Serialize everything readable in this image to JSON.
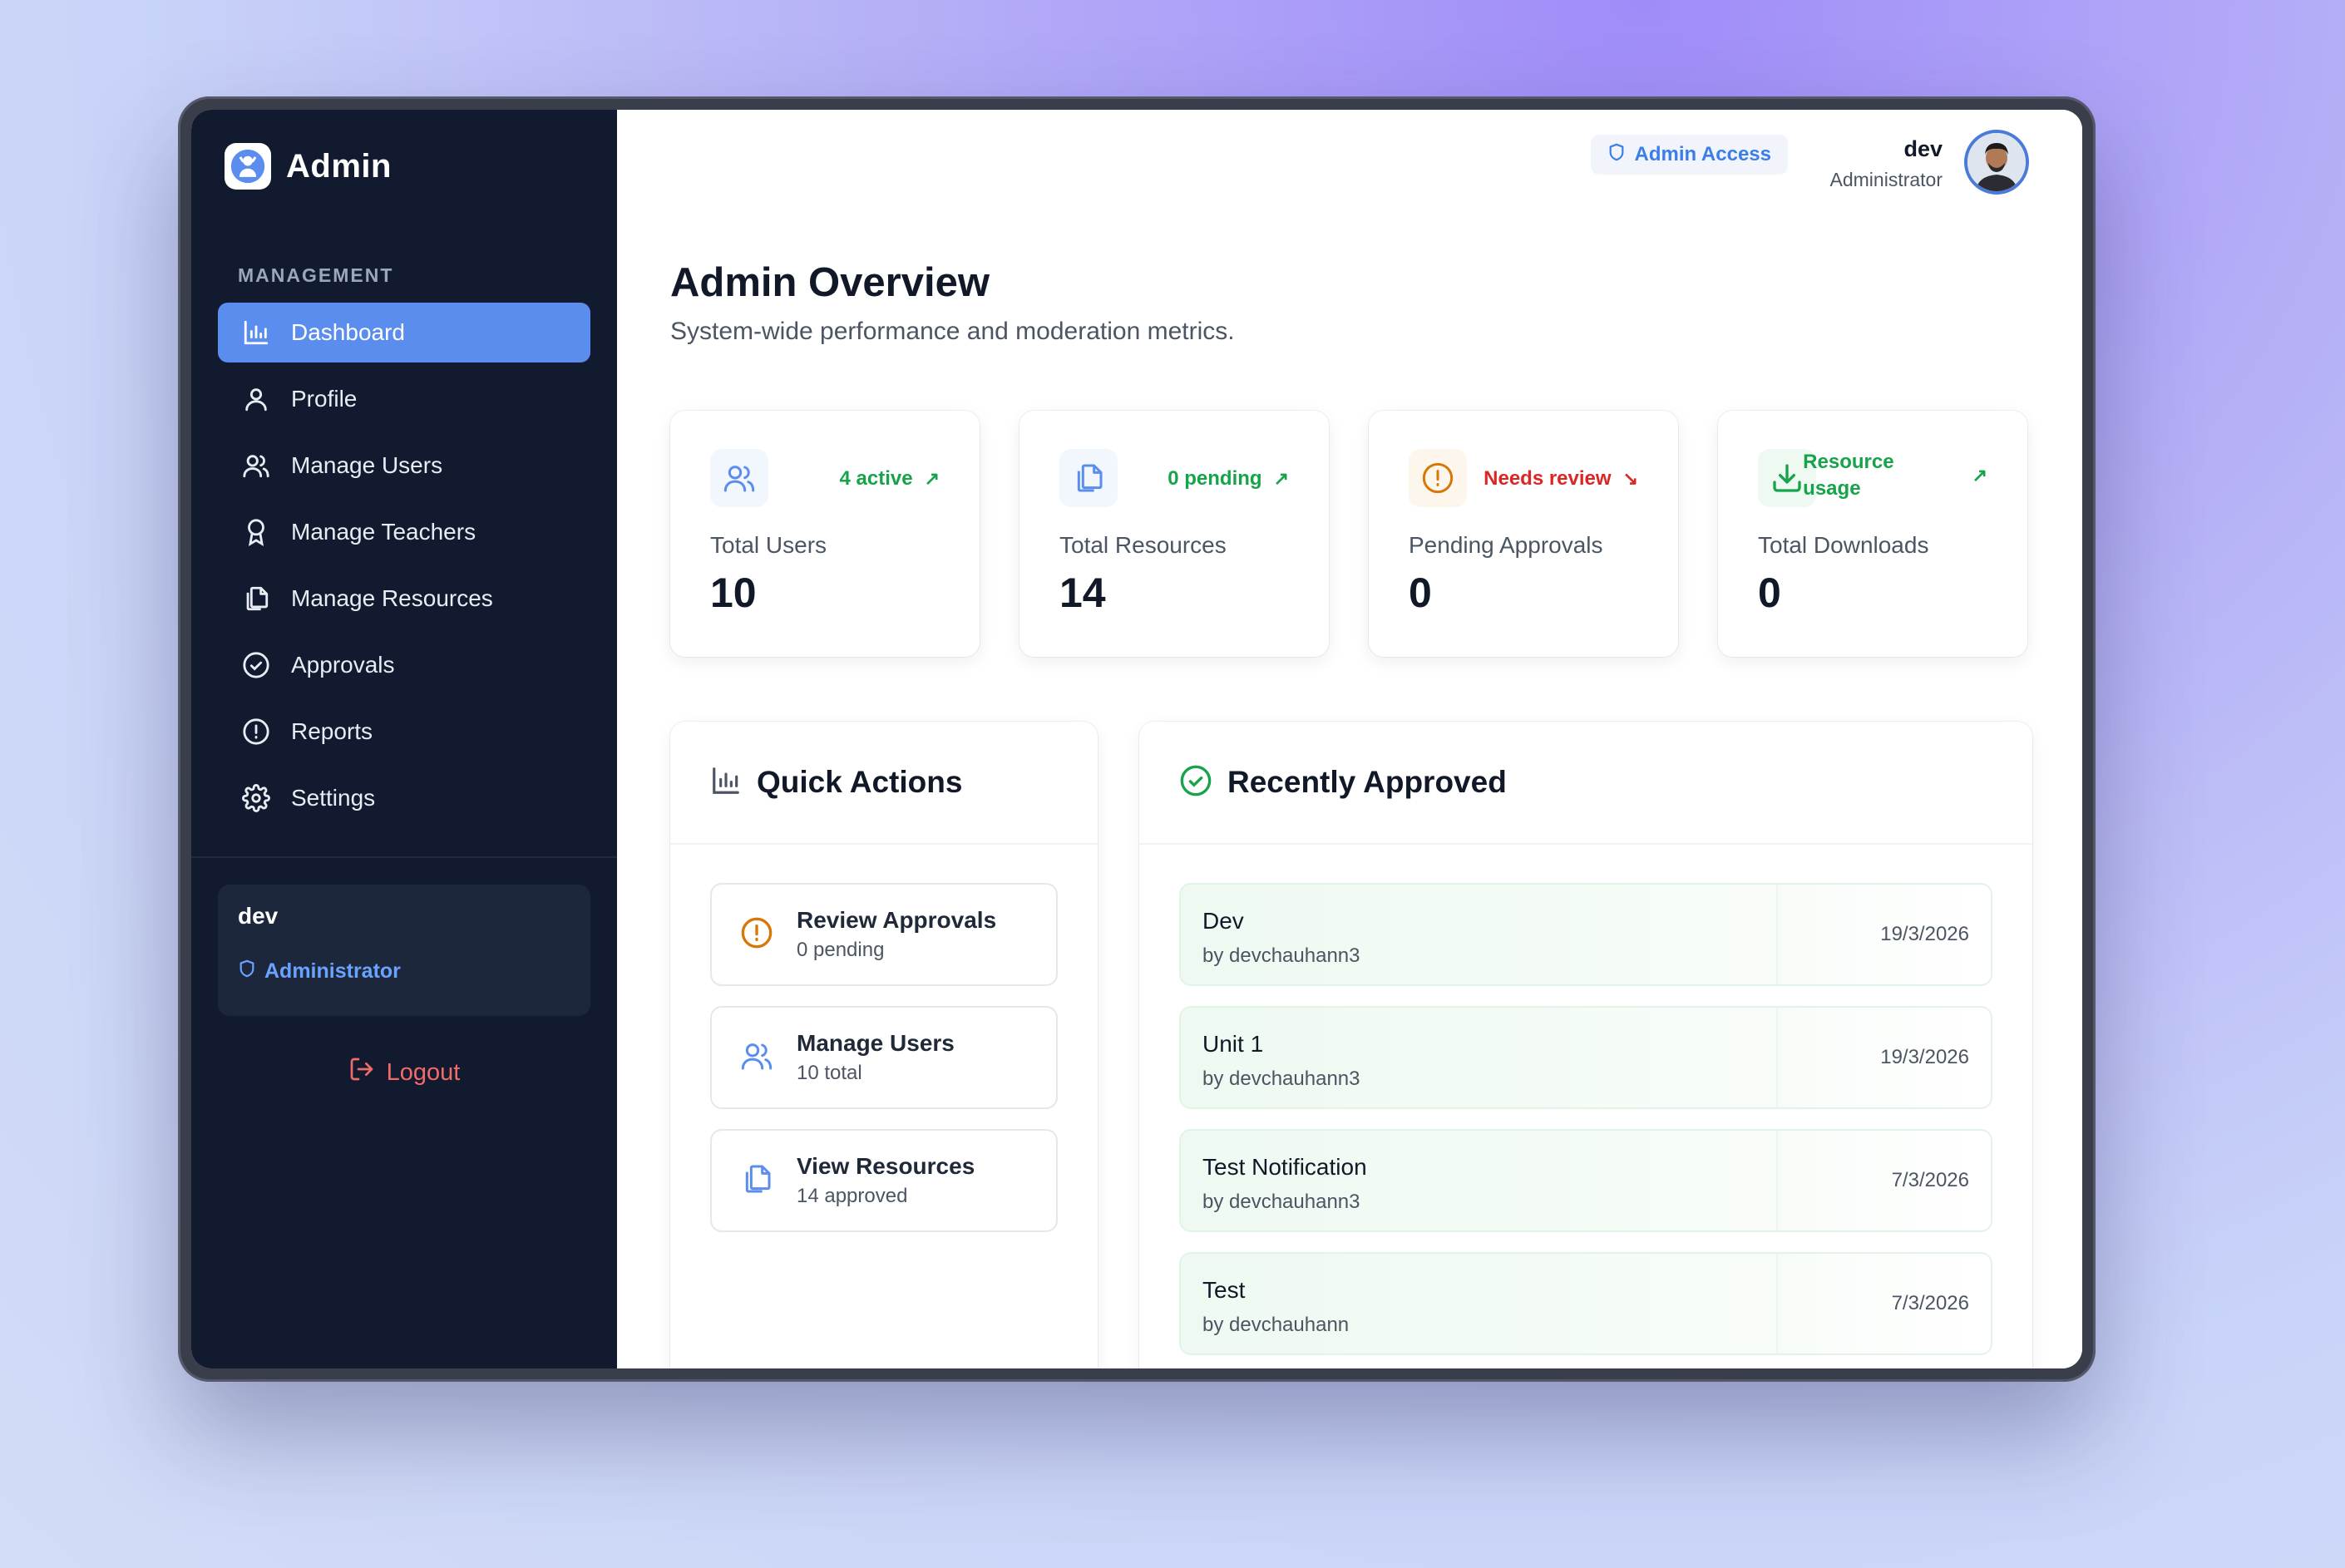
{
  "brand": {
    "title": "Admin"
  },
  "sidebar": {
    "section_label": "MANAGEMENT",
    "items": [
      {
        "label": "Dashboard",
        "icon": "bar-chart-icon",
        "active": true
      },
      {
        "label": "Profile",
        "icon": "user-icon"
      },
      {
        "label": "Manage Users",
        "icon": "users-icon"
      },
      {
        "label": "Manage Teachers",
        "icon": "award-icon"
      },
      {
        "label": "Manage Resources",
        "icon": "files-icon"
      },
      {
        "label": "Approvals",
        "icon": "check-circle-icon"
      },
      {
        "label": "Reports",
        "icon": "alert-circle-icon"
      },
      {
        "label": "Settings",
        "icon": "gear-icon"
      }
    ],
    "user": {
      "name": "dev",
      "role": "Administrator"
    },
    "logout_label": "Logout"
  },
  "header": {
    "admin_access_label": "Admin Access",
    "user_name": "dev",
    "user_role": "Administrator"
  },
  "page": {
    "title": "Admin Overview",
    "subtitle": "System-wide performance and moderation metrics."
  },
  "stats": [
    {
      "label": "Total Users",
      "value": "10",
      "badge": "4 active",
      "badge_color": "#16a34a",
      "icon": "users-icon"
    },
    {
      "label": "Total Resources",
      "value": "14",
      "badge": "0 pending",
      "badge_color": "#16a34a",
      "icon": "files-icon"
    },
    {
      "label": "Pending Approvals",
      "value": "0",
      "badge": "Needs review",
      "badge_color": "#dc2626",
      "icon": "alert-circle-icon"
    },
    {
      "label": "Total Downloads",
      "value": "0",
      "badge_line1": "Resource",
      "badge_line2": "usage",
      "badge_color": "#16a34a",
      "icon": "download-icon"
    }
  ],
  "quick_actions": {
    "title": "Quick Actions",
    "items": [
      {
        "title": "Review Approvals",
        "sub": "0 pending",
        "icon": "alert-circle-icon"
      },
      {
        "title": "Manage Users",
        "sub": "10 total",
        "icon": "users-icon"
      },
      {
        "title": "View Resources",
        "sub": "14 approved",
        "icon": "files-icon"
      }
    ]
  },
  "recently_approved": {
    "title": "Recently Approved",
    "items": [
      {
        "title": "Dev",
        "by": "by devchauhann3",
        "date": "19/3/2026"
      },
      {
        "title": "Unit 1",
        "by": "by devchauhann3",
        "date": "19/3/2026"
      },
      {
        "title": "Test Notification",
        "by": "by devchauhann3",
        "date": "7/3/2026"
      },
      {
        "title": "Test",
        "by": "by devchauhann",
        "date": "7/3/2026"
      }
    ]
  },
  "colors": {
    "sidebar_bg": "#111a2e",
    "accent": "#5b8def",
    "success": "#16a34a",
    "danger": "#dc2626",
    "warning": "#d97706"
  }
}
